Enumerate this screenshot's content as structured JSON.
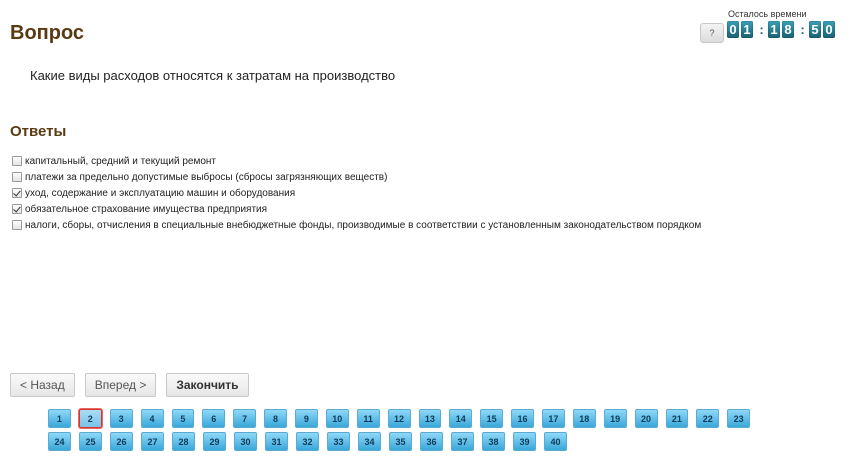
{
  "question": {
    "title": "Вопрос",
    "text": "Какие виды расходов относятся к затратам на производство"
  },
  "answers": {
    "title": "Ответы",
    "items": [
      {
        "text": "капитальный, средний и текущий ремонт",
        "checked": false
      },
      {
        "text": "платежи за предельно допустимые выбросы (сбросы загрязняющих веществ)",
        "checked": false
      },
      {
        "text": "уход, содержание и эксплуатацию машин и оборудования",
        "checked": true
      },
      {
        "text": "обязательное страхование имущества предприятия",
        "checked": true
      },
      {
        "text": "налоги, сборы, отчисления в специальные внебюджетные фонды, производимые в соответствии с установленным законодательством порядком",
        "checked": false
      }
    ]
  },
  "timer": {
    "help_label": "?",
    "label": "Осталось времени",
    "digits": [
      "0",
      "1",
      "1",
      "8",
      "5",
      "0"
    ],
    "separator": ":"
  },
  "nav": {
    "back_label": "< Назад",
    "forward_label": "Вперед >",
    "finish_label": "Закончить"
  },
  "pager": {
    "pages": [
      "1",
      "2",
      "3",
      "4",
      "5",
      "6",
      "7",
      "8",
      "9",
      "10",
      "11",
      "12",
      "13",
      "14",
      "15",
      "16",
      "17",
      "18",
      "19",
      "20",
      "21",
      "22",
      "23",
      "24",
      "25",
      "26",
      "27",
      "28",
      "29",
      "30",
      "31",
      "32",
      "33",
      "34",
      "35",
      "36",
      "37",
      "38",
      "39",
      "40"
    ],
    "current": "2"
  },
  "colors": {
    "heading": "#5a3a12",
    "digit_bg": "#1a5f72",
    "page_bg": "#3aa8da",
    "current_border": "#d8342e"
  }
}
